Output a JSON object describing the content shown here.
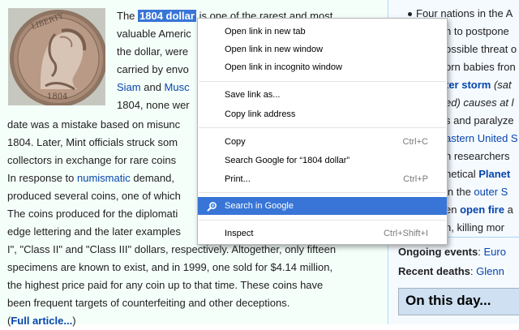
{
  "article": {
    "lines": [
      {
        "parts": [
          {
            "t": "The "
          },
          {
            "t": "1804 dollar",
            "hl": true
          },
          {
            "t": " is one of the rarest and most"
          }
        ]
      },
      {
        "parts": [
          {
            "t": "valuable Americ"
          }
        ]
      },
      {
        "parts": [
          {
            "t": "the dollar, were"
          }
        ]
      },
      {
        "parts": [
          {
            "t": "carried by envo"
          }
        ]
      },
      {
        "parts": [
          {
            "t": "Siam",
            "link": true
          },
          {
            "t": " and "
          },
          {
            "t": "Musc",
            "link": true
          }
        ]
      },
      {
        "parts": [
          {
            "t": "1804, none wer"
          }
        ]
      },
      {
        "parts": [
          {
            "t": "date was a mistake based on misunc"
          }
        ]
      },
      {
        "parts": [
          {
            "t": "1804. Later, Mint officials struck som"
          }
        ]
      },
      {
        "parts": [
          {
            "t": "collectors in exchange for rare coins"
          }
        ]
      },
      {
        "parts": [
          {
            "t": "In response to "
          },
          {
            "t": "numismatic",
            "link": true
          },
          {
            "t": " demand,"
          }
        ]
      },
      {
        "parts": [
          {
            "t": "produced several coins, one of which"
          }
        ]
      },
      {
        "parts": [
          {
            "t": "The coins produced for the diplomati"
          }
        ]
      },
      {
        "parts": [
          {
            "t": "edge lettering and the later examples"
          }
        ]
      },
      {
        "parts": [
          {
            "t": "I\", \"Class II\" and \"Class III\" dollars, respectively. Altogether, only fifteen"
          }
        ]
      },
      {
        "parts": [
          {
            "t": "specimens are known to exist, and in 1999, one sold for $4.14 million,"
          }
        ]
      },
      {
        "parts": [
          {
            "t": "the highest price paid for any coin up to that time. These coins have"
          }
        ]
      },
      {
        "parts": [
          {
            "t": "been frequent targets of counterfeiting and other deceptions."
          }
        ]
      },
      {
        "parts": [
          {
            "t": "("
          },
          {
            "t": "Full article...",
            "link": true,
            "bold": true
          },
          {
            "t": ")"
          }
        ]
      }
    ]
  },
  "news": {
    "lines": [
      {
        "parts": [
          {
            "t": "Four nations in the A"
          }
        ]
      },
      {
        "parts": [
          {
            "t": "n to postpone"
          }
        ]
      },
      {
        "parts": [
          {
            "t": "ossible threat o"
          }
        ]
      },
      {
        "parts": [
          {
            "t": "orn babies fron"
          }
        ]
      },
      {
        "parts": [
          {
            "t": "ter storm",
            "link": true,
            "bold": true
          },
          {
            "t": " (sat"
          }
        ]
      },
      {
        "parts": [
          {
            "t": "ed) causes at l"
          }
        ]
      },
      {
        "parts": [
          {
            "t": "s and paralyze"
          }
        ]
      },
      {
        "parts": [
          {
            "t": "astern United S",
            "link": true
          }
        ]
      },
      {
        "parts": [
          {
            "t": "h researchers"
          }
        ]
      },
      {
        "parts": [
          {
            "t": "hetical "
          },
          {
            "t": "Planet",
            "link": true,
            "bold": true
          }
        ]
      },
      {
        "parts": [
          {
            "t": " in the "
          },
          {
            "t": "outer S",
            "link": true
          }
        ]
      },
      {
        "parts": [
          {
            "t": "en "
          },
          {
            "t": "open fire",
            "link": true,
            "bold": true
          },
          {
            "t": " a"
          }
        ]
      },
      {
        "parts": [
          {
            "t": "n, killing mor"
          }
        ]
      },
      {
        "parts": [
          {
            "t": "Ongoing events",
            "bold": true
          },
          {
            "t": ": "
          },
          {
            "t": "Euro",
            "link": true
          }
        ]
      },
      {
        "parts": [
          {
            "t": "Recent deaths",
            "bold": true
          },
          {
            "t": ": "
          },
          {
            "t": "Glenn",
            "link": true
          }
        ]
      }
    ],
    "on_this_day": "On this day..."
  },
  "context_menu": {
    "items": [
      {
        "label": "Open link in new tab",
        "shortcut": ""
      },
      {
        "label": "Open link in new window",
        "shortcut": ""
      },
      {
        "label": "Open link in incognito window",
        "shortcut": ""
      },
      {
        "label": "Save link as...",
        "shortcut": ""
      },
      {
        "label": "Copy link address",
        "shortcut": ""
      },
      {
        "label": "Copy",
        "shortcut": "Ctrl+C"
      },
      {
        "label": "Search Google for “1804 dollar”",
        "shortcut": ""
      },
      {
        "label": "Print...",
        "shortcut": "Ctrl+P"
      },
      {
        "label": "Search in Google",
        "shortcut": "",
        "icon": "google-search-icon"
      },
      {
        "label": "Inspect",
        "shortcut": "Ctrl+Shift+I"
      }
    ],
    "selected_index": 8
  },
  "colors": {
    "link": "#0645ad",
    "selection": "#3875d7",
    "left_bg": "#f5fffa",
    "right_bg": "#f5faff",
    "header_bg": "#cee0f2"
  }
}
